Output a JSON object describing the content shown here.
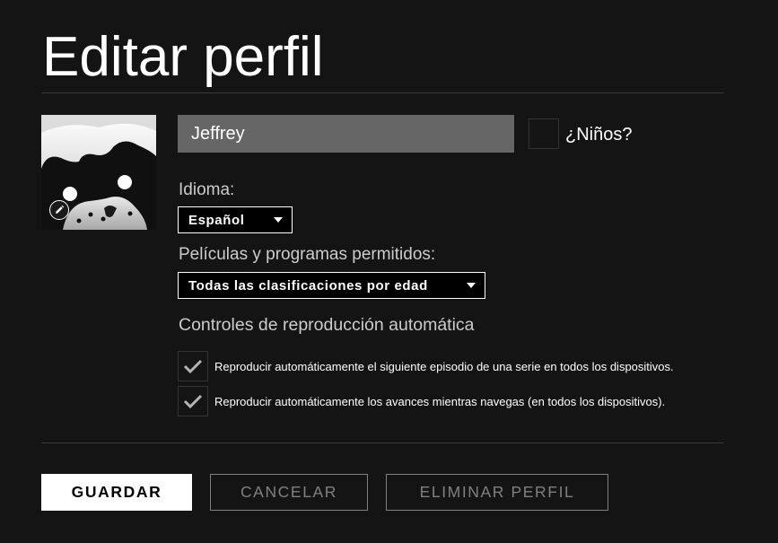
{
  "page": {
    "title": "Editar perfil"
  },
  "profile": {
    "name_value": "Jeffrey",
    "avatar_icon": "profile-avatar",
    "edit_icon": "pencil-icon"
  },
  "kids": {
    "label": "¿Niños?",
    "checked": false
  },
  "language": {
    "label": "Idioma:",
    "selected": "Español"
  },
  "maturity": {
    "label": "Películas y programas permitidos:",
    "selected": "Todas las clasificaciones por edad"
  },
  "autoplay": {
    "title": "Controles de reproducción automática",
    "options": [
      {
        "label": "Reproducir automáticamente el siguiente episodio de una serie en todos los dispositivos.",
        "checked": true
      },
      {
        "label": "Reproducir automáticamente los avances mientras navegas (en todos los dispositivos).",
        "checked": true
      }
    ]
  },
  "buttons": {
    "save": "GUARDAR",
    "cancel": "CANCELAR",
    "delete": "ELIMINAR PERFIL"
  },
  "colors": {
    "background": "#141414",
    "input_bg": "#666666",
    "muted_text": "#808080"
  }
}
